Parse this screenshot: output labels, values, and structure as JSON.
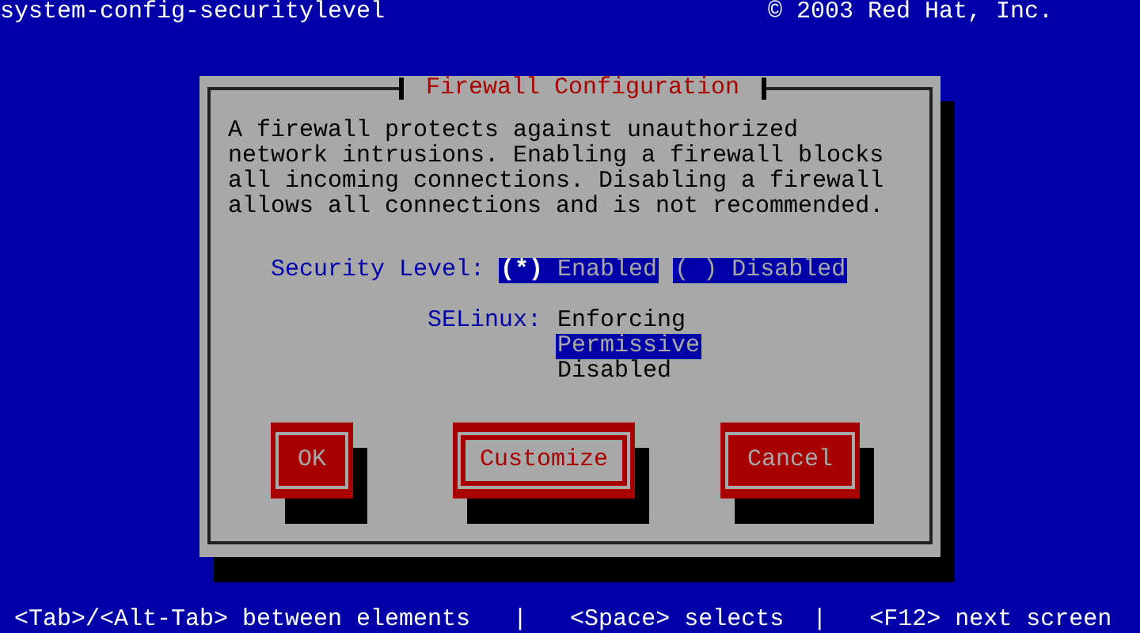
{
  "top_bar": {
    "app_name": "system-config-securitylevel",
    "copyright": "© 2003 Red Hat, Inc."
  },
  "dialog": {
    "title": "Firewall Configuration",
    "description": "A firewall protects against unauthorized network intrusions. Enabling a firewall blocks all incoming connections. Disabling a firewall allows all connections and is not recommended.",
    "security_level": {
      "label": "Security Level:",
      "marks": {
        "on": "(*)",
        "off": "( )"
      },
      "options": [
        {
          "label": "Enabled",
          "selected": true
        },
        {
          "label": "Disabled",
          "selected": false
        }
      ]
    },
    "selinux": {
      "label": "SELinux:",
      "options": [
        {
          "label": "Enforcing",
          "selected": false
        },
        {
          "label": "Permissive",
          "selected": true
        },
        {
          "label": "Disabled",
          "selected": false
        }
      ]
    },
    "buttons": [
      {
        "label": "OK",
        "focused": false
      },
      {
        "label": "Customize",
        "focused": true
      },
      {
        "label": "Cancel",
        "focused": false
      }
    ]
  },
  "help_line": "<Tab>/<Alt-Tab> between elements   |   <Space> selects  |   <F12> next screen"
}
